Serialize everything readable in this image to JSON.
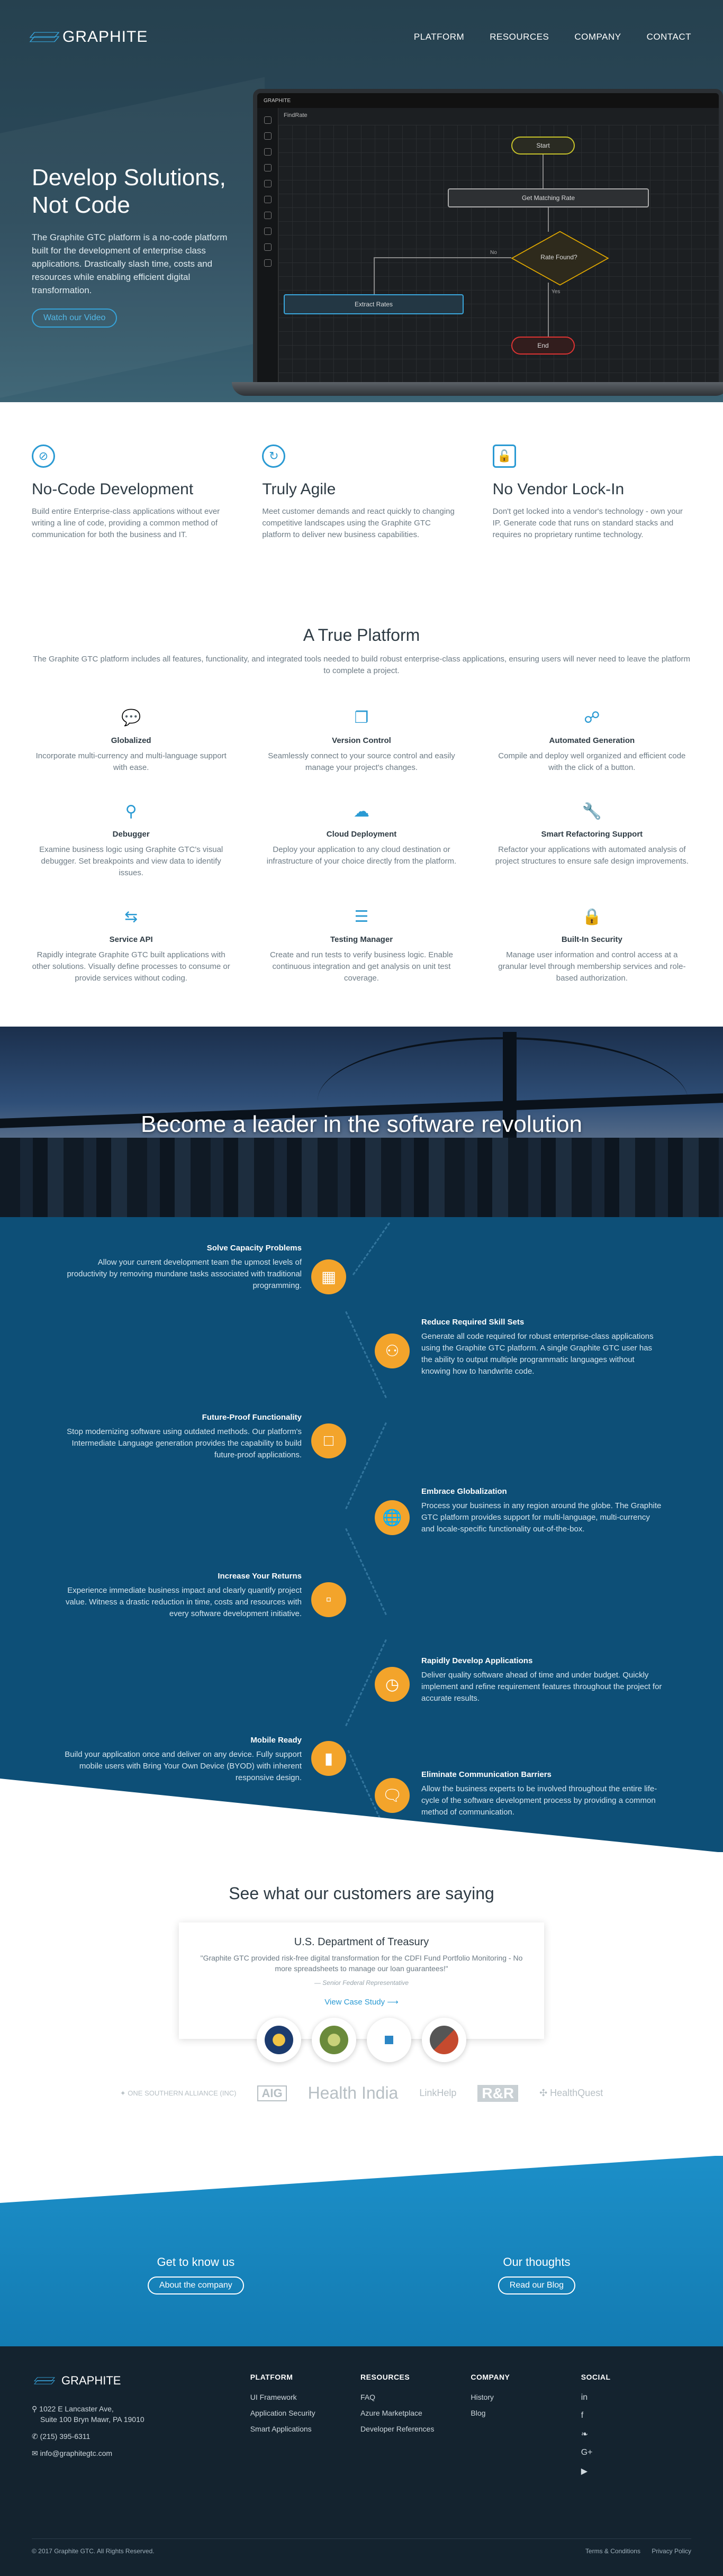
{
  "nav": {
    "brand": "GRAPHITE",
    "links": [
      "PLATFORM",
      "RESOURCES",
      "COMPANY",
      "CONTACT"
    ]
  },
  "hero": {
    "title": "Develop Solutions, Not Code",
    "body": "The Graphite GTC platform is a no-code platform built for the development of enterprise class applications. Drastically slash time, costs and resources while enabling efficient digital transformation.",
    "cta": "Watch our Video",
    "app": {
      "brand": "GRAPHITE",
      "title": "FindRate",
      "nodes": {
        "start": "Start",
        "task": "Get Matching Rate",
        "decision": "Rate Found?",
        "extract": "Extract Rates",
        "end": "End"
      },
      "yes": "Yes",
      "no": "No"
    }
  },
  "features": [
    {
      "icon": "no-code-icon",
      "title": "No-Code Development",
      "body": "Build entire Enterprise-class applications without ever writing a line of code, providing a common method of communication for both the business and IT."
    },
    {
      "icon": "agile-icon",
      "title": "Truly Agile",
      "body": "Meet customer demands and react quickly to changing competitive landscapes using the Graphite GTC platform to deliver new business capabilities."
    },
    {
      "icon": "unlock-icon",
      "title": "No Vendor Lock-In",
      "body": "Don't get locked into a vendor's technology - own your IP. Generate code that runs on standard stacks and requires no proprietary runtime technology."
    }
  ],
  "platform": {
    "title": "A True Platform",
    "lead": "The Graphite GTC platform includes all features, functionality, and integrated tools needed to build robust enterprise-class applications, ensuring users will never need to leave the platform to complete a project.",
    "items": [
      {
        "icon": "chat-bubbles-icon",
        "title": "Globalized",
        "body": "Incorporate multi-currency and multi-language support with ease."
      },
      {
        "icon": "windows-icon",
        "title": "Version Control",
        "body": "Seamlessly connect to your source control and easily manage your project's changes."
      },
      {
        "icon": "share-nodes-icon",
        "title": "Automated Generation",
        "body": "Compile and deploy well organized and efficient code with the click of a button."
      },
      {
        "icon": "magnifier-icon",
        "title": "Debugger",
        "body": "Examine business logic using Graphite GTC's visual debugger. Set breakpoints and view data to identify issues."
      },
      {
        "icon": "cloud-upload-icon",
        "title": "Cloud Deployment",
        "body": "Deploy your application to any cloud destination or infrastructure of your choice directly from the platform."
      },
      {
        "icon": "wrench-icon",
        "title": "Smart Refactoring Support",
        "body": "Refactor your applications with automated analysis of project structures to ensure safe design improvements."
      },
      {
        "icon": "api-arrows-icon",
        "title": "Service API",
        "body": "Rapidly integrate Graphite GTC built applications with other solutions. Visually define processes to consume or provide services without coding."
      },
      {
        "icon": "test-list-icon",
        "title": "Testing Manager",
        "body": "Create and run tests to verify business logic. Enable continuous integration and get analysis on unit test coverage."
      },
      {
        "icon": "padlock-icon",
        "title": "Built-In Security",
        "body": "Manage user information and control access at a granular level through membership services and role-based authorization."
      }
    ]
  },
  "banner": {
    "title": "Become a leader in the software revolution"
  },
  "benefits": [
    {
      "side": "left",
      "icon": "presentation-icon",
      "title": "Solve Capacity Problems",
      "body": "Allow your current development team the upmost levels of productivity by removing mundane tasks associated with traditional programming."
    },
    {
      "side": "right",
      "icon": "team-icon",
      "title": "Reduce Required Skill Sets",
      "body": "Generate all code required for robust enterprise-class applications using the Graphite GTC platform. A single Graphite GTC user has the ability to output multiple programmatic languages without knowing how to handwrite code."
    },
    {
      "side": "left",
      "icon": "future-icon",
      "title": "Future-Proof Functionality",
      "body": "Stop modernizing software using outdated methods. Our platform's Intermediate Language generation provides the capability to build future-proof applications."
    },
    {
      "side": "right",
      "icon": "globe-icon",
      "title": "Embrace Globalization",
      "body": "Process your business in any region around the globe. The Graphite GTC platform provides support for multi-language, multi-currency and locale-specific functionality out-of-the-box."
    },
    {
      "side": "left",
      "icon": "money-icon",
      "title": "Increase Your Returns",
      "body": "Experience immediate business impact and clearly quantify project value. Witness a drastic reduction in time, costs and resources with every software development initiative."
    },
    {
      "side": "right",
      "icon": "speed-icon",
      "title": "Rapidly Develop Applications",
      "body": "Deliver quality software ahead of time and under budget. Quickly implement and refine requirement features throughout the project for accurate results."
    },
    {
      "side": "left",
      "icon": "devices-icon",
      "title": "Mobile Ready",
      "body": "Build your application once and deliver on any device. Fully support mobile users with Bring Your Own Device (BYOD) with inherent responsive design."
    },
    {
      "side": "right",
      "icon": "speech-icon",
      "title": "Eliminate Communication Barriers",
      "body": "Allow the business experts to be involved throughout the entire life-cycle of the software development process by providing a common method of communication."
    }
  ],
  "testimonials": {
    "title": "See what our customers are saying",
    "org": "U.S. Department of Treasury",
    "quote": "\"Graphite GTC provided risk-free digital transformation for the CDFI Fund Portfolio Monitoring - No more spreadsheets to manage our loan guarantees!\"",
    "author": "— Senior Federal Representative",
    "link": "View Case Study ⟶",
    "seals": [
      "treasury-seal",
      "usda-seal",
      "health-cross-seal",
      "business-suit-seal"
    ],
    "logos": [
      "✦ ONE SOUTHERN ALLIANCE (INC)",
      "AIG",
      "Health India",
      "LinkHelp",
      "R&R",
      "✣ HealthQuest"
    ]
  },
  "cta": {
    "left": {
      "title": "Get to know us",
      "button": "About the company"
    },
    "right": {
      "title": "Our thoughts",
      "button": "Read our Blog"
    }
  },
  "footer": {
    "brand": "GRAPHITE",
    "address1": "1022 E Lancaster Ave,",
    "address2": "Suite 100 Bryn Mawr, PA 19010",
    "phone": "(215) 395-6311",
    "email": "info@graphitegtc.com",
    "columns": [
      {
        "title": "PLATFORM",
        "links": [
          "UI Framework",
          "Application Security",
          "Smart Applications"
        ]
      },
      {
        "title": "RESOURCES",
        "links": [
          "FAQ",
          "Azure Marketplace",
          "Developer References"
        ]
      },
      {
        "title": "COMPANY",
        "links": [
          "History",
          "Blog"
        ]
      }
    ],
    "social_title": "SOCIAL",
    "social": [
      "in",
      "f",
      "❧",
      "G+",
      "▶"
    ],
    "copyright": "© 2017 Graphite GTC. All Rights Reserved.",
    "legal": [
      "Terms & Conditions",
      "Privacy Policy"
    ]
  }
}
